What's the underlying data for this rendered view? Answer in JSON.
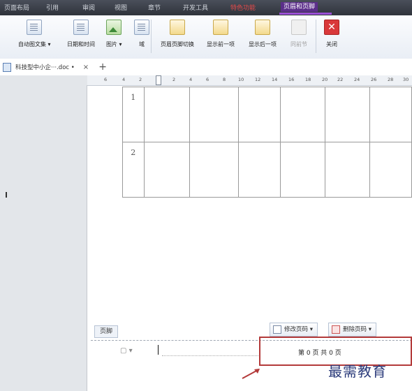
{
  "menu_tabs": [
    "页面布局",
    "引用",
    "审阅",
    "视图",
    "章节",
    "开发工具",
    "特色功能",
    "页眉和页脚"
  ],
  "ribbon": {
    "buttons": [
      "自动图文集 ▾",
      "日期和时间",
      "图片 ▾",
      "域",
      "页眉页脚切换",
      "显示前一项",
      "显示后一项",
      "同前节",
      "关闭"
    ]
  },
  "doc_tab": {
    "name": "科技型中小企···.doc •",
    "close": "×",
    "new": "+"
  },
  "ruler_ticks": [
    "6",
    "4",
    "2",
    "2",
    "4",
    "6",
    "8",
    "10",
    "12",
    "14",
    "16",
    "18",
    "20",
    "22",
    "24",
    "26",
    "28",
    "30"
  ],
  "table": {
    "rows": [
      "1",
      "2"
    ]
  },
  "footer": {
    "label": "页脚",
    "modify_button": "修改页码 ▾",
    "delete_button": "删除页码 ▾",
    "page_text": "第 0 页 共 0 页",
    "icon_label": "▾"
  },
  "watermark": "最需教育",
  "colors": {
    "menubar": "#2f333b",
    "active_tab": "#5b2e8a",
    "highlight": "#b33a3a",
    "watermark": "#2a3a7a"
  }
}
